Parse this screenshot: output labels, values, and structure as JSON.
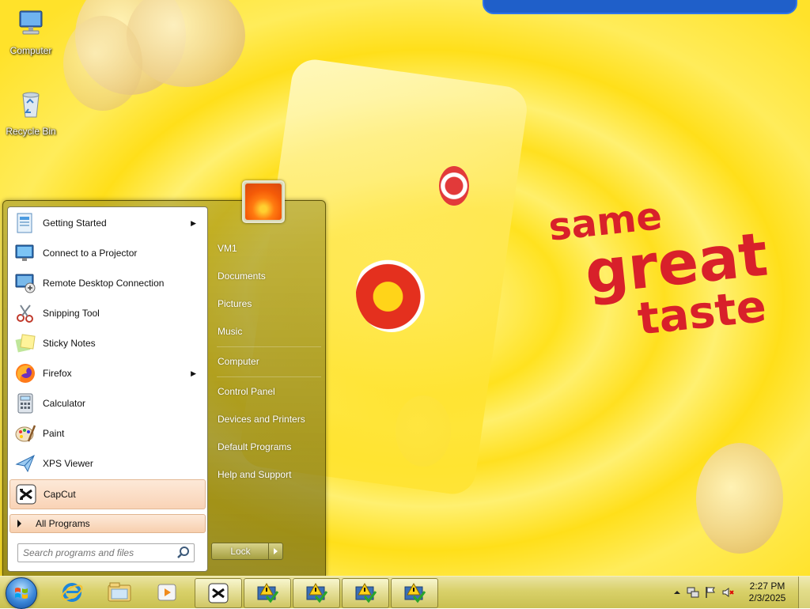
{
  "desktop": {
    "icons": [
      {
        "label": "Computer",
        "icon": "computer-icon"
      },
      {
        "label": "Recycle Bin",
        "icon": "recycle-bin-icon"
      }
    ],
    "wallpaper": {
      "slogan_line1": "same",
      "slogan_line2": "great",
      "slogan_line3": "taste",
      "accent_color": "#d8202a"
    }
  },
  "start_menu": {
    "programs": [
      {
        "label": "Getting Started",
        "icon": "getting-started-icon",
        "has_submenu": true
      },
      {
        "label": "Connect to a Projector",
        "icon": "projector-icon",
        "has_submenu": false
      },
      {
        "label": "Remote Desktop Connection",
        "icon": "remote-desktop-icon",
        "has_submenu": false
      },
      {
        "label": "Snipping Tool",
        "icon": "scissors-icon",
        "has_submenu": false
      },
      {
        "label": "Sticky Notes",
        "icon": "sticky-notes-icon",
        "has_submenu": false
      },
      {
        "label": "Firefox",
        "icon": "firefox-icon",
        "has_submenu": true
      },
      {
        "label": "Calculator",
        "icon": "calculator-icon",
        "has_submenu": false
      },
      {
        "label": "Paint",
        "icon": "paint-palette-icon",
        "has_submenu": false
      },
      {
        "label": "XPS Viewer",
        "icon": "xps-viewer-icon",
        "has_submenu": false
      },
      {
        "label": "CapCut",
        "icon": "capcut-icon",
        "has_submenu": false,
        "highlighted": true
      }
    ],
    "all_programs": "All Programs",
    "search_placeholder": "Search programs and files",
    "right_items": [
      {
        "label": "VM1"
      },
      {
        "label": "Documents"
      },
      {
        "label": "Pictures"
      },
      {
        "label": "Music"
      },
      {
        "label": "Computer"
      },
      {
        "label": "Control Panel"
      },
      {
        "label": "Devices and Printers"
      },
      {
        "label": "Default Programs"
      },
      {
        "label": "Help and Support"
      }
    ],
    "lock_label": "Lock"
  },
  "taskbar": {
    "pinned": [
      {
        "icon": "internet-explorer-icon"
      },
      {
        "icon": "file-explorer-icon"
      },
      {
        "icon": "media-player-icon"
      }
    ],
    "apps": [
      {
        "icon": "capcut-icon"
      },
      {
        "icon": "warning-installer-icon"
      },
      {
        "icon": "warning-installer-icon"
      },
      {
        "icon": "warning-installer-icon"
      },
      {
        "icon": "warning-installer-icon"
      }
    ],
    "clock_time": "2:27 PM",
    "clock_date": "2/3/2025"
  }
}
